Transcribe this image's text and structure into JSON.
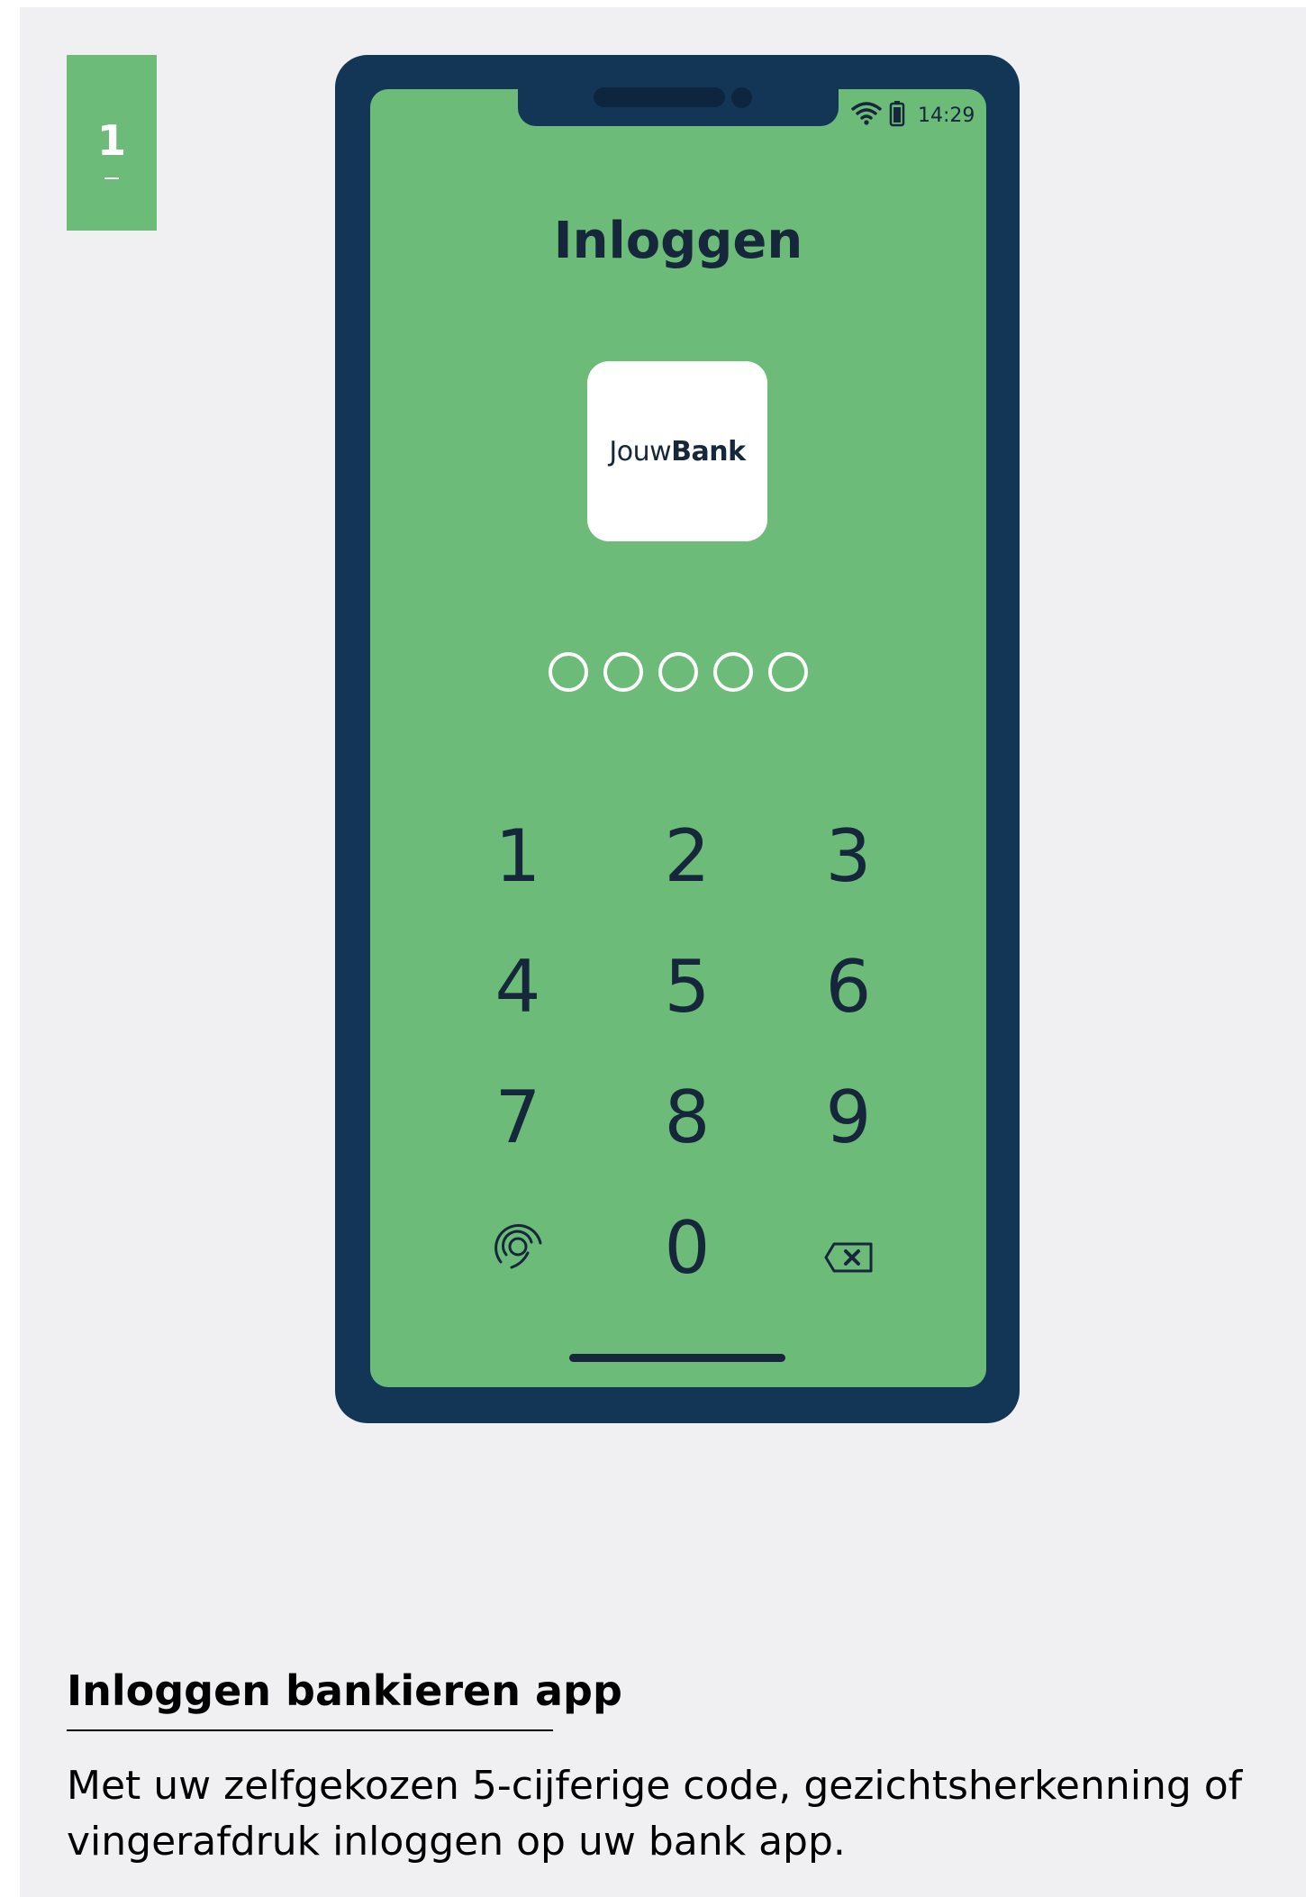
{
  "step": {
    "number": "1"
  },
  "phone": {
    "status_bar": {
      "time": "14:29",
      "icons": [
        "wifi-icon",
        "battery-icon"
      ]
    },
    "screen_title": "Inloggen",
    "logo": {
      "part1": "Jouw",
      "part2": "Bank"
    },
    "pin_length": 5,
    "keypad": {
      "keys": [
        "1",
        "2",
        "3",
        "4",
        "5",
        "6",
        "7",
        "8",
        "9",
        "0"
      ],
      "left_icon": "fingerprint-icon",
      "right_icon": "backspace-icon"
    }
  },
  "caption": {
    "title": "Inloggen bankieren app",
    "body": "Met uw zelfgekozen 5-cijferige code, gezichtsherkenning of vingerafdruk inloggen op uw bank app."
  },
  "colors": {
    "accent_green": "#6dbb78",
    "phone_navy": "#133657",
    "text_dark": "#16273c",
    "background": "#f0f0f2"
  }
}
